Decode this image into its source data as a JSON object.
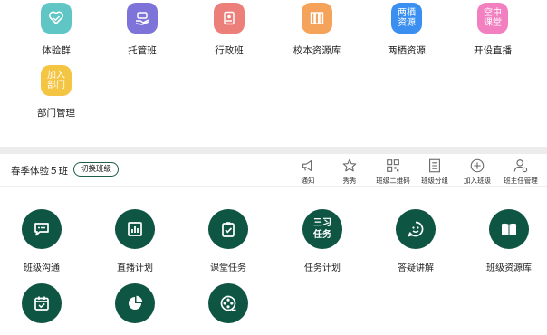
{
  "top_apps": [
    {
      "label": "体验群",
      "icon": "heart-chat-icon",
      "color": "#5fc6c5",
      "icon_text": ""
    },
    {
      "label": "托管班",
      "icon": "hand-care-icon",
      "color": "#7e73d8",
      "icon_text": ""
    },
    {
      "label": "行政班",
      "icon": "clipboard-icon",
      "color": "#ec7f7a",
      "icon_text": ""
    },
    {
      "label": "校本资源库",
      "icon": "books-icon",
      "color": "#f5a35b",
      "icon_text": ""
    },
    {
      "label": "两栖资源",
      "icon": "text-badge-icon",
      "color": "#3a8ff0",
      "icon_text": "两栖\n资源"
    },
    {
      "label": "开设直播",
      "icon": "text-badge-icon",
      "color": "#f27fc0",
      "icon_text": "空中\n课堂"
    },
    {
      "label": "部门管理",
      "icon": "text-badge-icon",
      "color": "#f4c443",
      "icon_text": "加入\n部门"
    }
  ],
  "class_bar": {
    "class_name": "春季体验５班",
    "switch_label": "切换班级",
    "tools": [
      {
        "label": "通知",
        "icon": "megaphone-icon"
      },
      {
        "label": "秀秀",
        "icon": "star-icon"
      },
      {
        "label": "班级二维码",
        "icon": "qrcode-icon"
      },
      {
        "label": "班级分组",
        "icon": "list-icon"
      },
      {
        "label": "加入班级",
        "icon": "plus-circle-icon"
      },
      {
        "label": "班主任管理",
        "icon": "user-gear-icon"
      }
    ]
  },
  "functions": [
    {
      "label": "班级沟通",
      "icon": "chat-bubble-icon"
    },
    {
      "label": "直播计划",
      "icon": "bar-chart-icon"
    },
    {
      "label": "课堂任务",
      "icon": "clipboard-check-icon"
    },
    {
      "label": "任务计划",
      "icon": "text-icon",
      "icon_text": "三习\n任务"
    },
    {
      "label": "答疑讲解",
      "icon": "smile-chat-icon"
    },
    {
      "label": "班级资源库",
      "icon": "open-book-icon"
    },
    {
      "label": "",
      "icon": "calendar-check-icon"
    },
    {
      "label": "",
      "icon": "pie-chart-icon"
    },
    {
      "label": "",
      "icon": "film-reel-icon"
    }
  ],
  "colors": {
    "accent_green": "#0f5543",
    "divider": "#ececec"
  }
}
